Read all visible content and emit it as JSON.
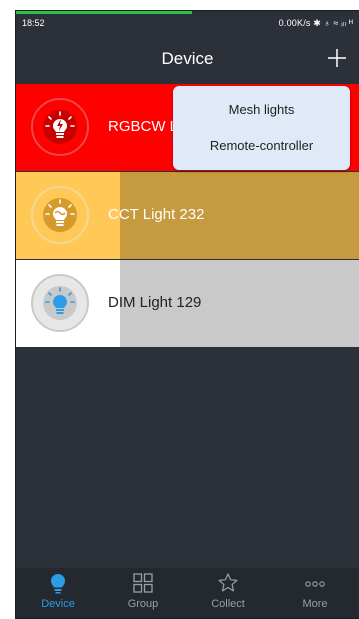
{
  "status_bar": {
    "time": "18:52",
    "network": "0.00K/s ✱ ♁ ≈ ᵢₗₗ ᴴ"
  },
  "header": {
    "title": "Device",
    "add_icon": "plus-icon"
  },
  "devices": [
    {
      "name": "RGBCW Light",
      "icon": "lightning-bulb-icon",
      "color": "#ff0000"
    },
    {
      "name": "CCT Light 232",
      "icon": "wave-bulb-icon",
      "color": "#ffc857"
    },
    {
      "name": "DIM Light 129",
      "icon": "blue-bulb-icon",
      "color": "#2a9de6"
    }
  ],
  "popup_menu": {
    "items": [
      "Mesh lights",
      "Remote-controller"
    ]
  },
  "tabs": [
    {
      "label": "Device",
      "icon": "bulb-icon",
      "active": true
    },
    {
      "label": "Group",
      "icon": "grid-icon",
      "active": false
    },
    {
      "label": "Collect",
      "icon": "star-icon",
      "active": false
    },
    {
      "label": "More",
      "icon": "more-dots-icon",
      "active": false
    }
  ],
  "colors": {
    "background": "#2c3139",
    "accent": "#2a9de6",
    "popup": "#dfe9f8"
  }
}
